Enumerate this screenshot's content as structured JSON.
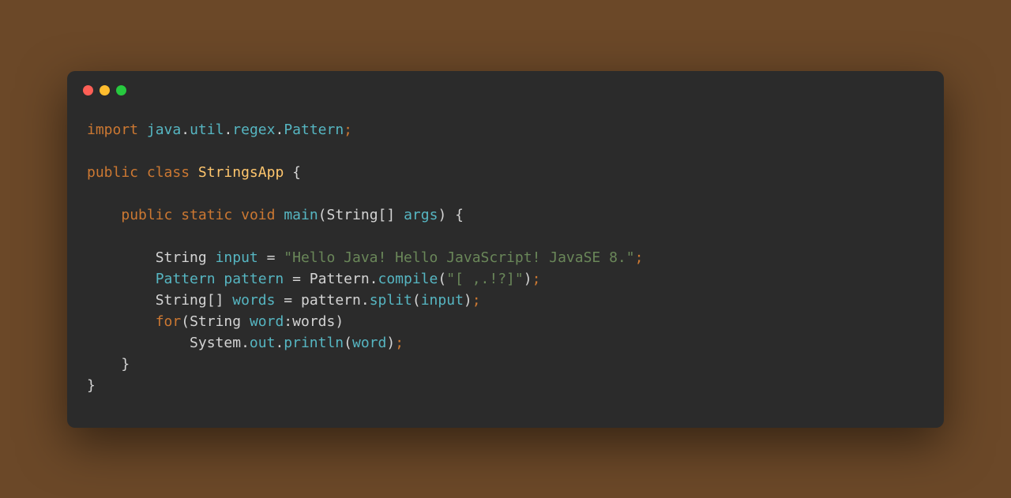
{
  "window": {
    "buttons": {
      "close": "red",
      "minimize": "yellow",
      "maximize": "green"
    }
  },
  "code": {
    "kw_import": "import",
    "pkg_java": "java",
    "pkg_util": "util",
    "pkg_regex": "regex",
    "pkg_Pattern": "Pattern",
    "kw_public": "public",
    "kw_class": "class",
    "class_name": "StringsApp",
    "kw_static": "static",
    "kw_void": "void",
    "method_main": "main",
    "type_String": "String",
    "param_args": "args",
    "var_input": "input",
    "str_literal": "\"Hello Java! Hello JavaScript! JavaSE 8.\"",
    "type_Pattern": "Pattern",
    "var_pattern": "pattern",
    "method_compile": "compile",
    "str_regex": "\"[ ,.!?]\"",
    "var_words": "words",
    "method_split": "split",
    "kw_for": "for",
    "var_word": "word",
    "obj_System": "System",
    "field_out": "out",
    "method_println": "println",
    "dot": ".",
    "semi": ";",
    "lbrace": "{",
    "rbrace": "}",
    "lparen": "(",
    "rparen": ")",
    "lbracket": "[",
    "rbracket": "]",
    "eq": "=",
    "colon": ":",
    "space": " "
  }
}
